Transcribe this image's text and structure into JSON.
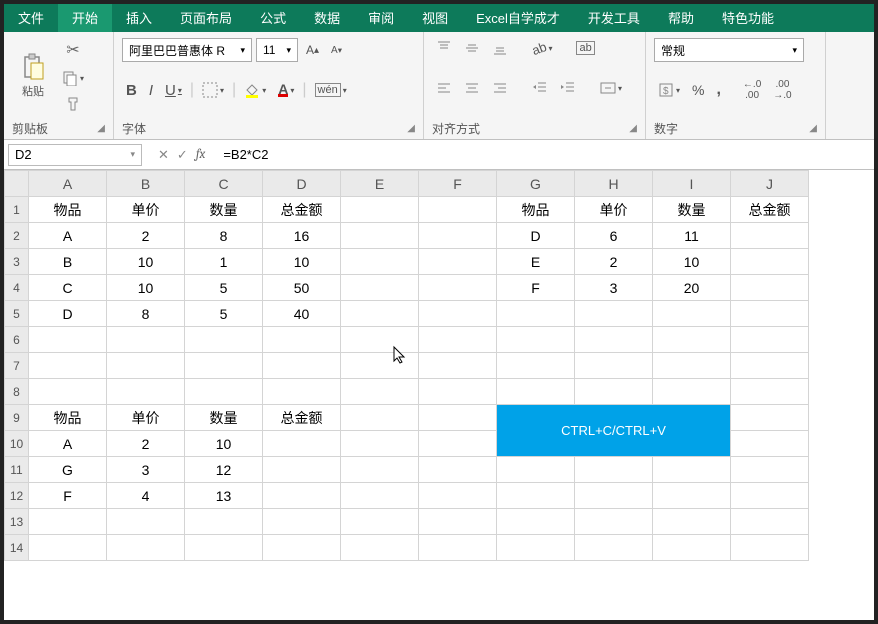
{
  "menubar": {
    "tabs": [
      {
        "label": "文件"
      },
      {
        "label": "开始",
        "active": true
      },
      {
        "label": "插入"
      },
      {
        "label": "页面布局"
      },
      {
        "label": "公式"
      },
      {
        "label": "数据"
      },
      {
        "label": "审阅"
      },
      {
        "label": "视图"
      },
      {
        "label": "Excel自学成才"
      },
      {
        "label": "开发工具"
      },
      {
        "label": "帮助"
      },
      {
        "label": "特色功能"
      }
    ]
  },
  "ribbon": {
    "clipboard": {
      "label": "剪贴板",
      "paste": "粘贴"
    },
    "font": {
      "label": "字体",
      "name": "阿里巴巴普惠体 R",
      "size": "11",
      "bold": "B",
      "italic": "I",
      "underline": "U"
    },
    "align": {
      "label": "对齐方式",
      "wrap": "ab"
    },
    "number": {
      "label": "数字",
      "format": "常规",
      "currency": "$",
      "percent": "%",
      "comma": ",",
      "inc": ".0←",
      "dec": "→.0"
    }
  },
  "formulaBar": {
    "cellRef": "D2",
    "formula": "=B2*C2",
    "cancel": "✕",
    "confirm": "✓",
    "fx": "fx"
  },
  "columns": [
    "A",
    "B",
    "C",
    "D",
    "E",
    "F",
    "G",
    "H",
    "I",
    "J"
  ],
  "rows": [
    [
      "物品",
      "单价",
      "数量",
      "总金额",
      "",
      "",
      "物品",
      "单价",
      "数量",
      "总金额"
    ],
    [
      "A",
      "2",
      "8",
      "16",
      "",
      "",
      "D",
      "6",
      "11",
      ""
    ],
    [
      "B",
      "10",
      "1",
      "10",
      "",
      "",
      "E",
      "2",
      "10",
      ""
    ],
    [
      "C",
      "10",
      "5",
      "50",
      "",
      "",
      "F",
      "3",
      "20",
      ""
    ],
    [
      "D",
      "8",
      "5",
      "40",
      "",
      "",
      "",
      "",
      "",
      ""
    ],
    [
      "",
      "",
      "",
      "",
      "",
      "",
      "",
      "",
      "",
      ""
    ],
    [
      "",
      "",
      "",
      "",
      "",
      "",
      "",
      "",
      "",
      ""
    ],
    [
      "",
      "",
      "",
      "",
      "",
      "",
      "",
      "",
      "",
      ""
    ],
    [
      "物品",
      "单价",
      "数量",
      "总金额",
      "",
      "",
      "",
      "",
      "",
      ""
    ],
    [
      "A",
      "2",
      "10",
      "",
      "",
      "",
      "",
      "",
      "",
      ""
    ],
    [
      "G",
      "3",
      "12",
      "",
      "",
      "",
      "",
      "",
      "",
      ""
    ],
    [
      "F",
      "4",
      "13",
      "",
      "",
      "",
      "",
      "",
      "",
      ""
    ],
    [
      "",
      "",
      "",
      "",
      "",
      "",
      "",
      "",
      "",
      ""
    ],
    [
      "",
      "",
      "",
      "",
      "",
      "",
      "",
      "",
      "",
      ""
    ]
  ],
  "callout": {
    "text": "CTRL+C/CTRL+V",
    "rowStart": 8,
    "rowEnd": 9,
    "colStart": 6,
    "colEnd": 8
  }
}
